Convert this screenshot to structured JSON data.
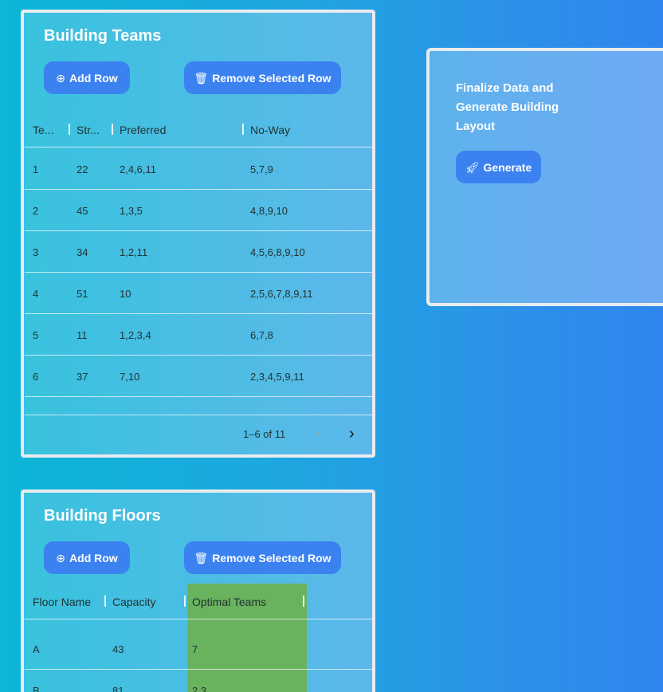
{
  "teams": {
    "title": "Building Teams",
    "add_label": "Add Row",
    "remove_label": "Remove Selected Row",
    "columns": [
      "Te...",
      "Str...",
      "Preferred",
      "No-Way"
    ],
    "rows": [
      [
        "1",
        "22",
        "2,4,6,11",
        "5,7,9"
      ],
      [
        "2",
        "45",
        "1,3,5",
        "4,8,9,10"
      ],
      [
        "3",
        "34",
        "1,2,11",
        "4,5,6,8,9,10"
      ],
      [
        "4",
        "51",
        "10",
        "2,5,6,7,8,9,11"
      ],
      [
        "5",
        "11",
        "1,2,3,4",
        "6,7,8"
      ],
      [
        "6",
        "37",
        "7,10",
        "2,3,4,5,9,11"
      ]
    ],
    "pagination": "1–6 of 11"
  },
  "floors": {
    "title": "Building Floors",
    "add_label": "Add Row",
    "remove_label": "Remove Selected Row",
    "columns": [
      "Floor Name",
      "Capacity",
      "Optimal Teams"
    ],
    "rows": [
      [
        "A",
        "43",
        "7"
      ],
      [
        "B",
        "81",
        "2,3"
      ]
    ]
  },
  "generate": {
    "text": "Finalize Data and Generate Building Layout",
    "button_label": "Generate"
  },
  "colors": {
    "button": "#3b82f0",
    "highlight_column": "#6ab35e"
  }
}
